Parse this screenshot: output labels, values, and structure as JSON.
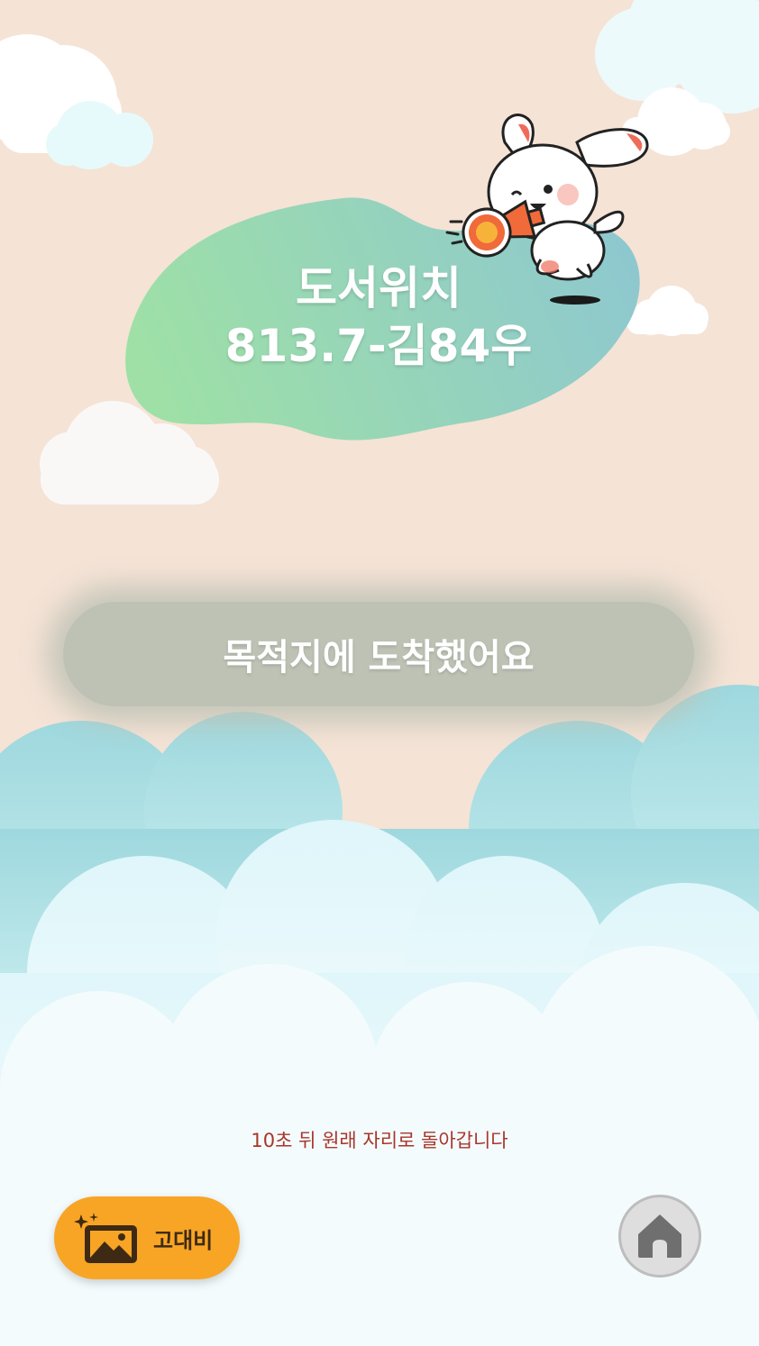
{
  "location": {
    "title": "도서위치",
    "call_number": "813.7-김84우"
  },
  "arrival_message": "목적지에 도착했어요",
  "countdown_message": "10초 뒤 원래 자리로 돌아갑니다",
  "contrast_button": {
    "label": "고대비",
    "icon": "high-contrast-image-icon"
  },
  "home_button": {
    "icon": "home-icon"
  },
  "mascot": {
    "icon": "bunny-megaphone-mascot"
  },
  "colors": {
    "background": "#f5e3d6",
    "blob_gradient_start": "#9ee0a6",
    "blob_gradient_end": "#8ec8cf",
    "banner": "#bec2b5",
    "countdown_text": "#a8362a",
    "contrast_button": "#f8a525",
    "home_button": "#dedede",
    "home_icon": "#6f6f6f"
  }
}
